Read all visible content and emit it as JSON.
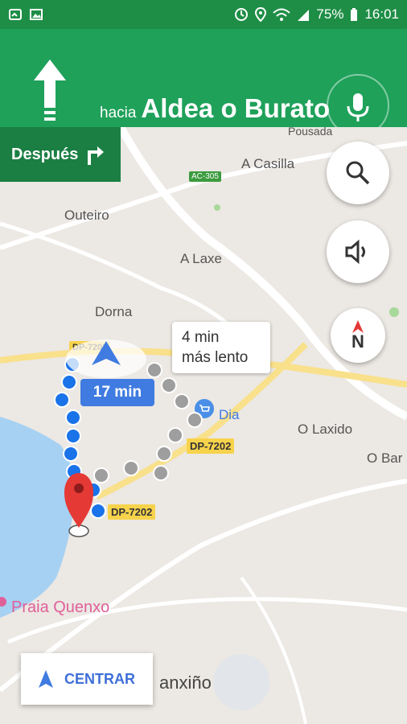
{
  "status_bar": {
    "battery": "75%",
    "time": "16:01"
  },
  "navigation": {
    "direction_prefix": "hacia",
    "destination": "Aldea o Burato",
    "next_maneuver_label": "Después"
  },
  "map": {
    "places": [
      "Pousada",
      "A Casilla",
      "Outeiro",
      "A Laxe",
      "Dorna",
      "O Laxido",
      "O Bar",
      "Praia Quenxo",
      "anxiño",
      "Dia"
    ],
    "roads": [
      "AC-305",
      "DP-7202",
      "DP-7202",
      "DP-7202"
    ],
    "route_alt_time": "4 min",
    "route_alt_note": "más lento",
    "route_main_time": "17 min"
  },
  "buttons": {
    "recenter_label": "CENTRAR",
    "compass_letter": "N"
  },
  "colors": {
    "nav_green": "#1fa15a",
    "dark_green": "#1b7f43",
    "route_blue": "#1a73e8",
    "alt_gray": "#9e9e9e",
    "water": "#a6d1f3"
  }
}
